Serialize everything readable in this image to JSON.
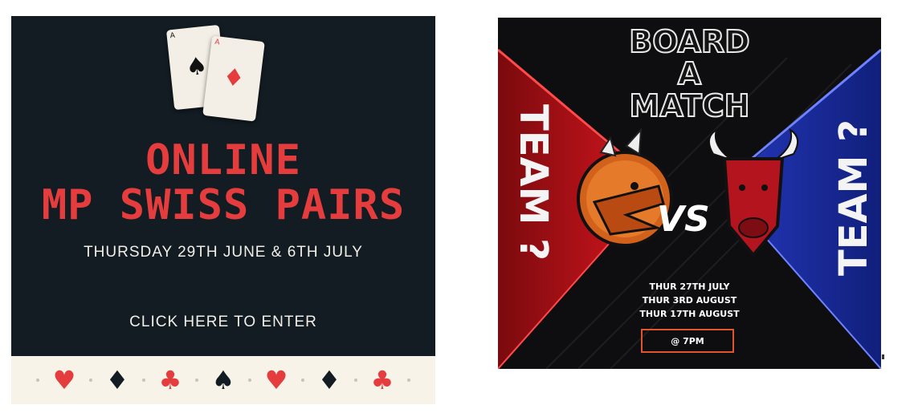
{
  "left_panel": {
    "title_line1": "ONLINE",
    "title_line2": "MP SWISS PAIRS",
    "dates": "THURSDAY 29TH JUNE & 6TH JULY",
    "cta": "CLICK HERE TO ENTER",
    "card1_rank": "A",
    "card2_rank": "A",
    "suits_row": [
      "♥",
      "♦",
      "♣",
      "♠",
      "♥",
      "♦",
      "♣"
    ],
    "colors": {
      "background": "#121c22",
      "title": "#e53d3d",
      "strip": "#f7f3e9"
    }
  },
  "right_panel": {
    "title": [
      "BOARD",
      "A",
      "MATCH"
    ],
    "team_left": "TEAM ?",
    "team_right": "TEAM ?",
    "vs": "VS",
    "dates": [
      "THUR 27TH JULY",
      "THUR 3RD AUGUST",
      "THUR 17TH AUGUST"
    ],
    "time": "@ 7PM",
    "colors": {
      "left_team": "#d4161e",
      "right_team": "#2336b8",
      "accent": "#e2552c"
    }
  }
}
